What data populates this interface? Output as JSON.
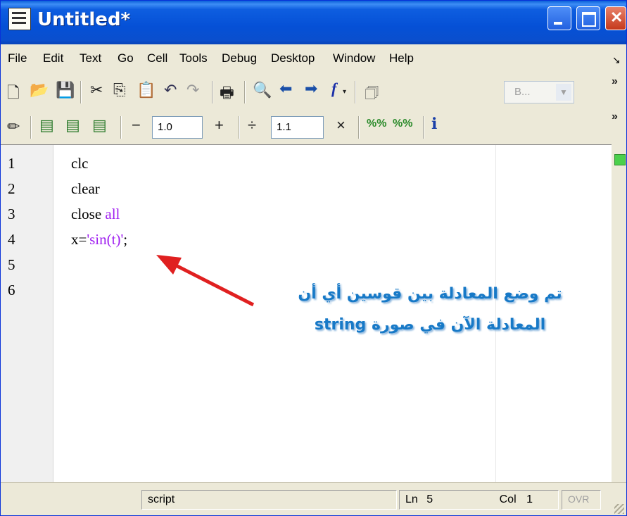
{
  "window": {
    "title": "Untitled*"
  },
  "menu": [
    "File",
    "Edit",
    "Text",
    "Go",
    "Cell",
    "Tools",
    "Debug",
    "Desktop",
    "Window",
    "Help"
  ],
  "toolbar1": {
    "icons": [
      "new-file-icon",
      "open-folder-icon",
      "save-icon",
      "cut-icon",
      "copy-icon",
      "paste-icon",
      "undo-icon",
      "redo-icon",
      "print-icon",
      "find-icon",
      "back-arrow-icon",
      "forward-arrow-icon",
      "function-icon",
      "stack-icon"
    ],
    "base_combo_label": "B...",
    "overflow": "»"
  },
  "toolbar2": {
    "cell_minus": "−",
    "cell_value_1": "1.0",
    "cell_plus": "+",
    "cell_divide": "÷",
    "cell_value_2": "1.1",
    "cell_times": "×",
    "overflow": "»"
  },
  "editor": {
    "line_numbers": [
      "1",
      "2",
      "3",
      "4",
      "5",
      "6"
    ],
    "lines": [
      {
        "plain": "clc",
        "kw": "",
        "str": "",
        "tail": ""
      },
      {
        "plain": "clear",
        "kw": "",
        "str": "",
        "tail": ""
      },
      {
        "plain": "close ",
        "kw": "all",
        "str": "",
        "tail": ""
      },
      {
        "plain": "x=",
        "kw": "",
        "str": "'sin(t)'",
        "tail": ";"
      }
    ]
  },
  "annotation": {
    "line1": "تم وضع المعادلة بين قوسين أي أن",
    "line2": "المعادلة الآن في صورة string",
    "arrow_color": "#e02020"
  },
  "status": {
    "mode": "script",
    "ln_label": "Ln",
    "ln_value": "5",
    "col_label": "Col",
    "col_value": "1",
    "ovr": "OVR"
  }
}
